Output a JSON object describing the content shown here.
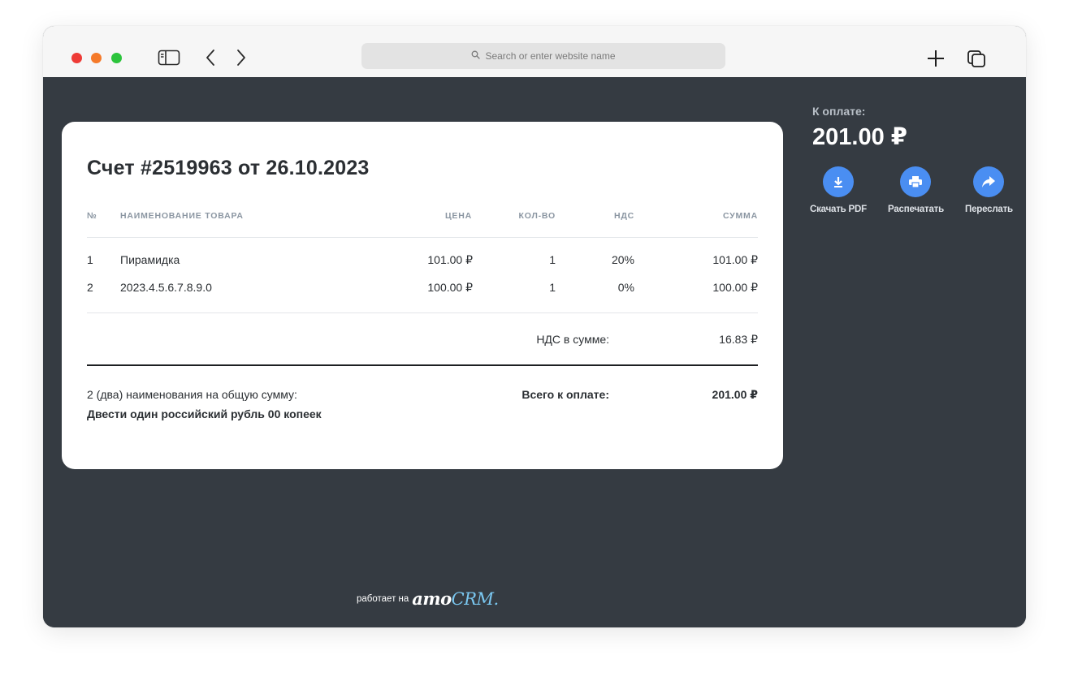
{
  "browser": {
    "url_placeholder": "Search or enter website name"
  },
  "invoice": {
    "title": "Счет #2519963 от 26.10.2023",
    "columns": {
      "num": "№",
      "name": "Наименование товара",
      "price": "Цена",
      "qty": "Кол-во",
      "vat": "НДС",
      "sum": "Сумма"
    },
    "items": [
      {
        "num": "1",
        "name": "Пирамидка",
        "price": "101.00 ₽",
        "qty": "1",
        "vat": "20%",
        "sum": "101.00 ₽"
      },
      {
        "num": "2",
        "name": "2023.4.5.6.7.8.9.0",
        "price": "100.00 ₽",
        "qty": "1",
        "vat": "0%",
        "sum": "100.00 ₽"
      }
    ],
    "vat_total_label": "НДС в сумме:",
    "vat_total_value": "16.83 ₽",
    "count_text": "2 (два) наименования на общую сумму:",
    "amount_words": "Двести один российский рубль 00 копеек",
    "grand_total_label": "Всего к оплате:",
    "grand_total_value": "201.00 ₽"
  },
  "sidebar": {
    "due_label": "К оплате:",
    "due_value": "201.00 ₽",
    "actions": {
      "download": "Скачать PDF",
      "print": "Распечатать",
      "forward": "Переслать"
    }
  },
  "footer": {
    "powered_by": "работает на",
    "logo_amo": "amo",
    "logo_crm": "CRM."
  },
  "colors": {
    "background": "#353b42",
    "accent": "#4a8ef2"
  }
}
